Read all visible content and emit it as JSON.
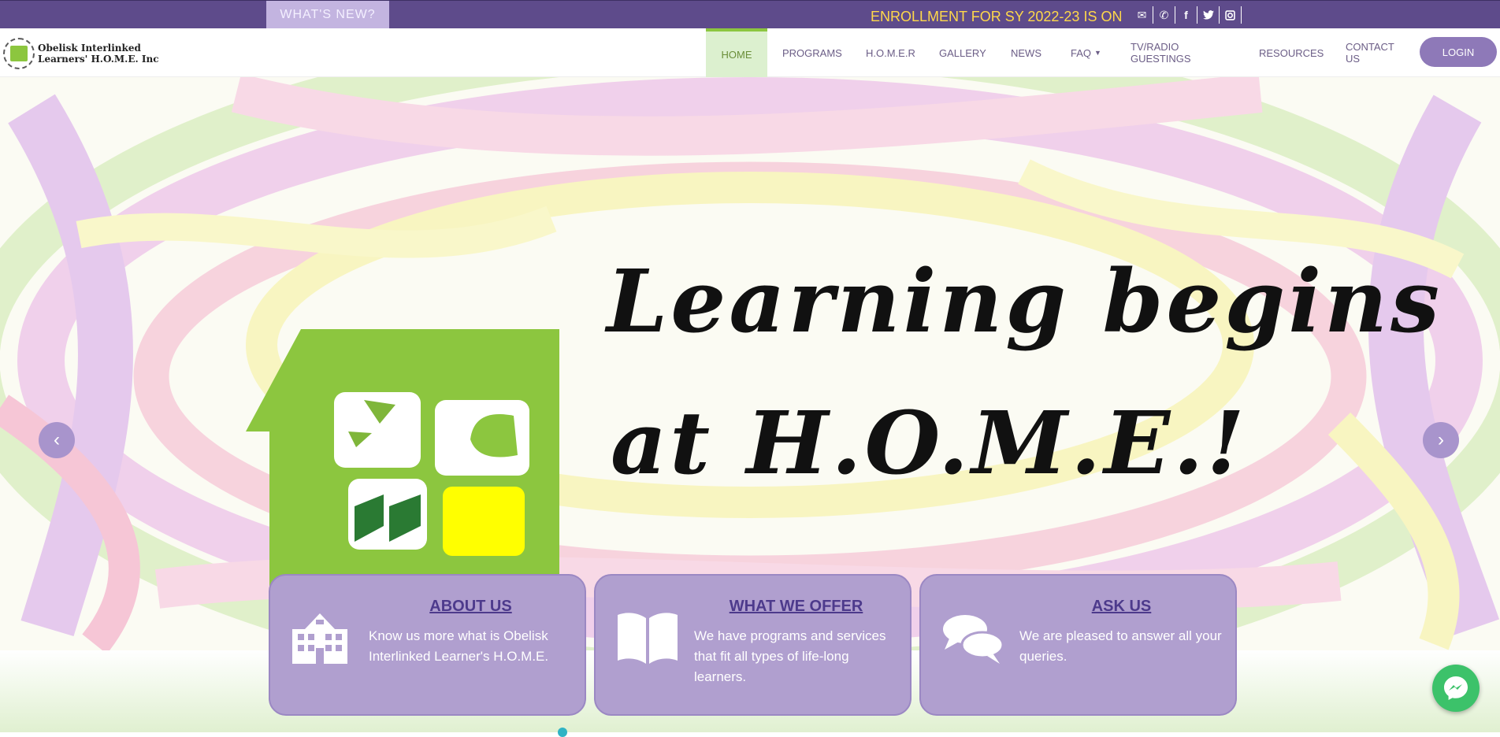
{
  "topbar": {
    "whats_new": "WHAT'S NEW?",
    "ticker": "ENROLLMENT FOR SY 2022-23 IS ON",
    "social_icons": [
      "envelope-icon",
      "phone-icon",
      "facebook-icon",
      "twitter-icon",
      "instagram-icon"
    ]
  },
  "brand": {
    "line1": "Obelisk Interlinked",
    "line2": "Learners' H.O.M.E. Inc"
  },
  "nav": {
    "items": [
      "HOME",
      "PROGRAMS",
      "H.O.M.E.R",
      "GALLERY",
      "NEWS",
      "FAQ",
      "TV/RADIO GUESTINGS",
      "RESOURCES",
      "CONTACT US"
    ],
    "login": "LOGIN"
  },
  "hero": {
    "line1": "Learning begins",
    "line2": "at H.O.M.E.!",
    "prev": "‹",
    "next": "›"
  },
  "cards": [
    {
      "title": "ABOUT US",
      "text": "Know us more what is Obelisk Interlinked Learner's H.O.M.E.",
      "icon": "school-building-icon"
    },
    {
      "title": "WHAT WE OFFER",
      "text": "We have programs and services that fit all types of life-long learners.",
      "icon": "open-book-icon"
    },
    {
      "title": "ASK US",
      "text": "We are pleased to answer all your queries.",
      "icon": "chat-bubbles-icon"
    }
  ],
  "colors": {
    "brand_purple": "#5e4b8b",
    "card_purple": "#b09fcf",
    "brand_green": "#8cc63f",
    "ticker_yellow": "#ffd84a"
  }
}
